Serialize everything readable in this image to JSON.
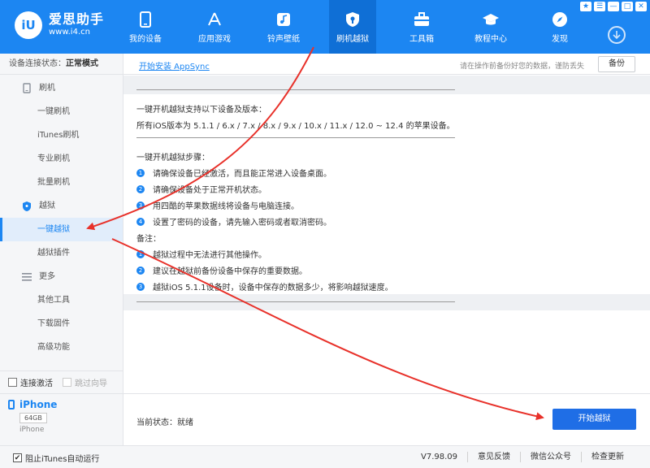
{
  "app": {
    "name": "爱思助手",
    "url": "www.i4.cn",
    "logo_text": "iU"
  },
  "nav": [
    {
      "label": "我的设备",
      "icon": "phone-icon"
    },
    {
      "label": "应用游戏",
      "icon": "app-store-icon"
    },
    {
      "label": "铃声壁纸",
      "icon": "music-icon"
    },
    {
      "label": "刷机越狱",
      "icon": "shield-icon",
      "active": true
    },
    {
      "label": "工具箱",
      "icon": "toolbox-icon"
    },
    {
      "label": "教程中心",
      "icon": "graduation-cap-icon"
    },
    {
      "label": "发现",
      "icon": "compass-icon"
    }
  ],
  "window_controls": [
    "★",
    "☰",
    "—",
    "□",
    "✕"
  ],
  "sidebar": {
    "status_label": "设备连接状态：",
    "status_value": "正常模式",
    "groups": [
      {
        "label": "刷机",
        "icon": "flash-icon",
        "items": [
          "一键刷机",
          "iTunes刷机",
          "专业刷机",
          "批量刷机"
        ]
      },
      {
        "label": "越狱",
        "icon": "jailbreak-shield-icon",
        "items": [
          "一键越狱",
          "越狱插件"
        ],
        "selected": "一键越狱"
      },
      {
        "label": "更多",
        "icon": "menu-icon",
        "items": [
          "其他工具",
          "下载固件",
          "高级功能"
        ]
      }
    ],
    "check_activate": "连接激活",
    "check_skip": "跳过向导",
    "device_name": "iPhone",
    "device_capacity": "64GB",
    "device_model": "iPhone"
  },
  "main": {
    "appsync_link": "开始安装 AppSync",
    "backup_hint": "请在操作前备份好您的数据，谨防丢失",
    "backup_button": "备份",
    "support_title": "一键开机越狱支持以下设备及版本：",
    "support_text": "所有iOS版本为 5.1.1 / 6.x / 7.x / 8.x / 9.x / 10.x / 11.x / 12.0 ~ 12.4 的苹果设备。",
    "steps_title": "一键开机越狱步骤：",
    "steps": [
      "请确保设备已经激活，而且能正常进入设备桌面。",
      "请确保设备处于正常开机状态。",
      "用四酷的苹果数据线将设备与电脑连接。",
      "设置了密码的设备，请先输入密码或者取消密码。"
    ],
    "notes_title": "备注：",
    "notes": [
      "越狱过程中无法进行其他操作。",
      "建议在越狱前备份设备中保存的重要数据。",
      "越狱iOS 5.1.1设备时，设备中保存的数据多少，将影响越狱速度。"
    ],
    "current_status_label": "当前状态：",
    "current_status_value": "就绪",
    "start_button": "开始越狱"
  },
  "footer": {
    "itunes_check": "阻止iTunes自动运行",
    "version": "V7.98.09",
    "feedback": "意见反馈",
    "wechat": "微信公众号",
    "update": "检查更新"
  },
  "colors": {
    "brand": "#1c86f2",
    "active_nav": "#0f6fd6",
    "start_button": "#1f6ee6",
    "annotation_arrow": "#e8312a"
  }
}
